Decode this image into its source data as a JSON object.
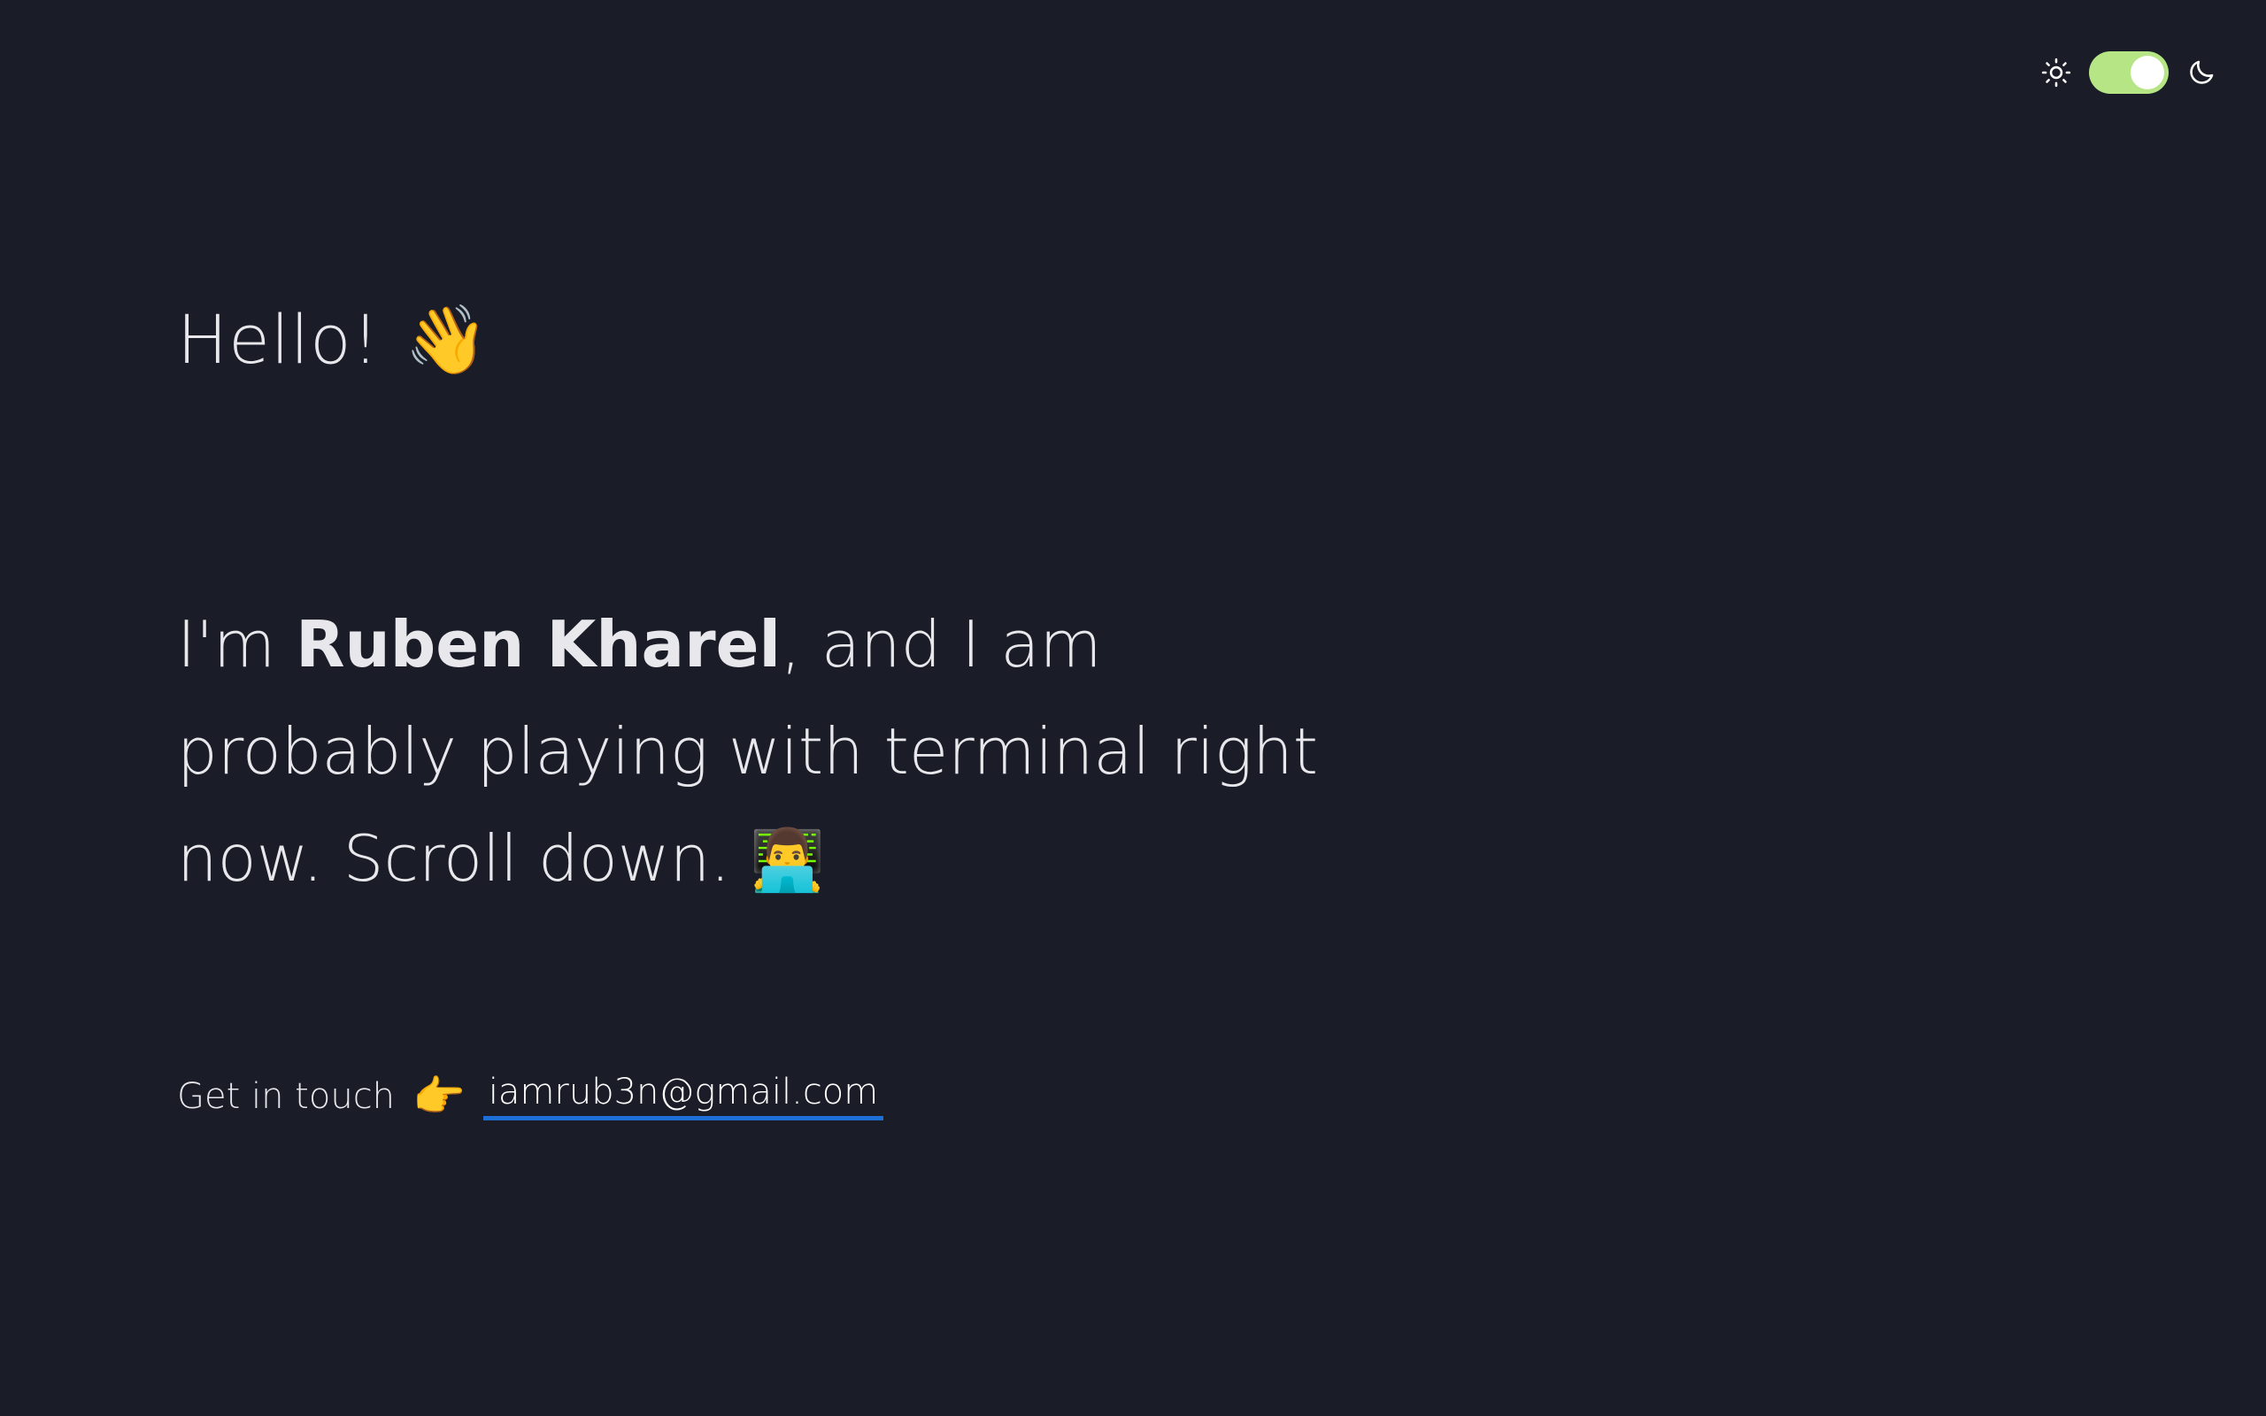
{
  "theme": {
    "accent_toggle_color": "#b6e585",
    "background_color": "#1a1d28",
    "link_underline_color": "#1d6fd6",
    "toggle_state": "dark",
    "light_icon": "sun-icon",
    "dark_icon": "moon-icon"
  },
  "hero": {
    "greeting": "Hello!",
    "greeting_emoji": "👋",
    "intro_prefix": "I'm ",
    "name": "Ruben Kharel",
    "intro_suffix": ", and I am probably playing with terminal right now. Scroll down.",
    "intro_emoji": "👨‍💻"
  },
  "contact": {
    "label": "Get in touch",
    "pointer_emoji": "👉",
    "email": "iamrub3n@gmail.com"
  }
}
